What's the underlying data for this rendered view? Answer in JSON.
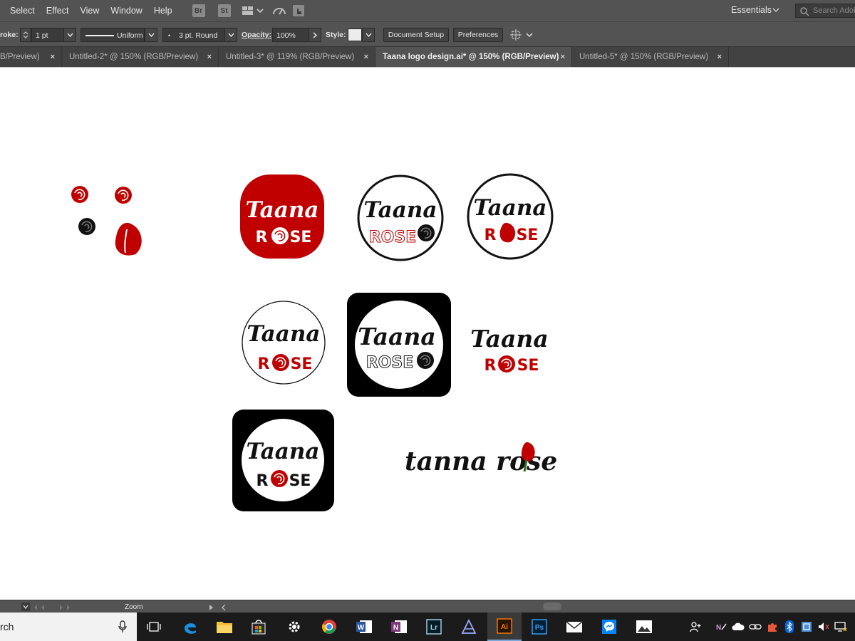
{
  "menu": {
    "items": [
      "Select",
      "Effect",
      "View",
      "Window",
      "Help"
    ]
  },
  "bridge": {
    "br": "Br",
    "st": "St"
  },
  "workspace": {
    "label": "Essentials",
    "search_placeholder": "Search Adobe"
  },
  "control": {
    "stroke_label": "roke:",
    "stroke_value": "1 pt",
    "profile": "Uniform",
    "brush": "3 pt. Round",
    "opacity_label": "Opacity:",
    "opacity_value": "100%",
    "style_label": "Style:",
    "doc_setup": "Document Setup",
    "preferences": "Preferences"
  },
  "tabs": [
    {
      "label": "B/Preview)"
    },
    {
      "label": "Untitled-2* @ 150% (RGB/Preview)"
    },
    {
      "label": "Untitled-3* @ 119% (RGB/Preview)"
    },
    {
      "label": "Taana logo design.ai* @ 150% (RGB/Preview)",
      "active": true
    },
    {
      "label": "Untitled-5* @ 150% (RGB/Preview)"
    }
  ],
  "tab_close": "×",
  "artwork": {
    "logo_word_1": "Taana",
    "logo_word_2": "ROSE",
    "rose_prefix": "R",
    "rose_suffix": "SE",
    "script_text": "tanna rose"
  },
  "status": {
    "zoom_label": "Zoom"
  },
  "taskbar": {
    "search_text": "rch"
  },
  "colors": {
    "rose_red": "#c00000",
    "ui_gray": "#535353",
    "dark_gray": "#424242"
  }
}
